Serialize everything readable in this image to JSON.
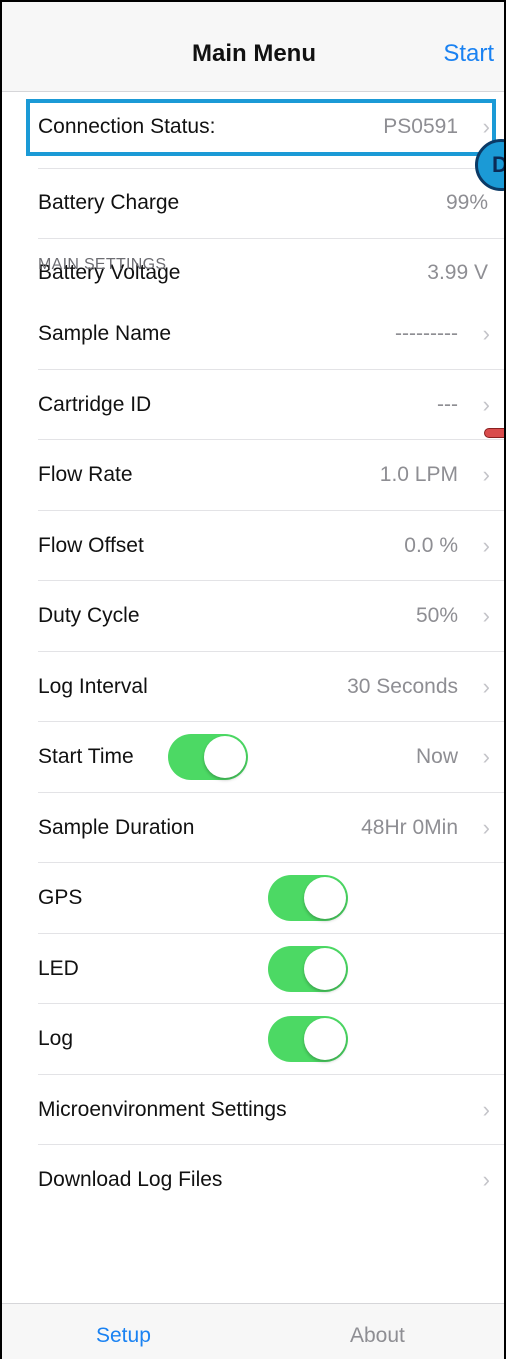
{
  "navbar": {
    "title": "Main Menu",
    "start_label": "Start"
  },
  "top_group": [
    {
      "label": "Connection Status:",
      "value": "PS0591"
    },
    {
      "label": "Battery Charge",
      "value": "99%"
    },
    {
      "label": "Battery Voltage",
      "value": "3.99 V"
    }
  ],
  "section_header": "MAIN SETTINGS",
  "settings": [
    {
      "label": "Sample Name",
      "value": "---------"
    },
    {
      "label": "Cartridge ID",
      "value": "---"
    },
    {
      "label": "Flow Rate",
      "value": "1.0 LPM"
    },
    {
      "label": "Flow Offset",
      "value": "0.0 %"
    },
    {
      "label": "Duty Cycle",
      "value": "50%"
    },
    {
      "label": "Log Interval",
      "value": "30 Seconds"
    },
    {
      "label": "Start Time",
      "value": "Now",
      "toggle_on": true
    },
    {
      "label": "Sample Duration",
      "value": "48Hr 0Min"
    },
    {
      "label": "GPS",
      "toggle_on": true
    },
    {
      "label": "LED",
      "toggle_on": true
    },
    {
      "label": "Log",
      "toggle_on": true
    },
    {
      "label": "Microenvironment Settings"
    },
    {
      "label": "Download Log Files"
    }
  ],
  "chevron": "›",
  "callout_letter": "D",
  "tabs": [
    {
      "label": "Setup",
      "color": "#1a82f2",
      "active": true
    },
    {
      "label": "About",
      "color": "#8e8e93",
      "active": false
    }
  ],
  "colors": {
    "accent": "#1a82f2",
    "toggle_on": "#4cd964",
    "highlight": "#1b9ad6"
  }
}
